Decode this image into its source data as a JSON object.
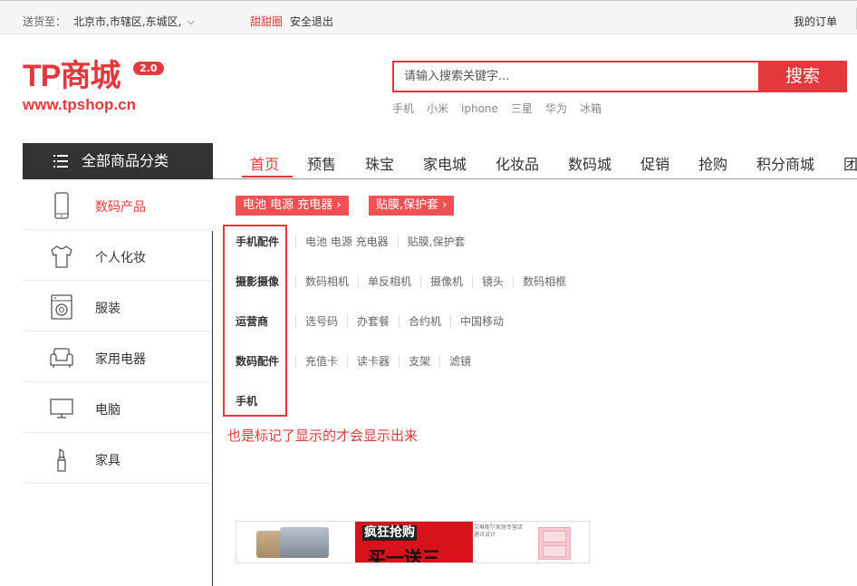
{
  "topbar": {
    "deliver_label": "送货至：",
    "location": "北京市,市辖区,东城区,",
    "username": "甜甜圈",
    "logout": "安全退出",
    "my_orders": "我的订单"
  },
  "logo": {
    "brand": "TP商城",
    "version": "2.0",
    "url": "www.tpshop.cn"
  },
  "search": {
    "placeholder": "请输入搜索关键字...",
    "button": "搜索",
    "hot_words": [
      "手机",
      "小米",
      "iphone",
      "三星",
      "华为",
      "冰箱"
    ]
  },
  "category_header": "全部商品分类",
  "nav": [
    "首页",
    "预售",
    "珠宝",
    "家电城",
    "化妆品",
    "数码城",
    "促销",
    "抢购",
    "积分商城",
    "团"
  ],
  "sidebar": [
    {
      "label": "数码产品",
      "icon": "phone-icon"
    },
    {
      "label": "个人化妆",
      "icon": "tshirt-icon"
    },
    {
      "label": "服装",
      "icon": "washer-icon"
    },
    {
      "label": "家用电器",
      "icon": "sofa-icon"
    },
    {
      "label": "电脑",
      "icon": "monitor-icon"
    },
    {
      "label": "家具",
      "icon": "lipstick-icon"
    }
  ],
  "tags": [
    "电池 电源 充电器",
    "贴膜,保护套"
  ],
  "subcategories": [
    {
      "title": "手机配件",
      "links": [
        "电池 电源 充电器",
        "贴膜,保护套"
      ]
    },
    {
      "title": "摄影摄像",
      "links": [
        "数码相机",
        "单反相机",
        "摄像机",
        "镜头",
        "数码相框"
      ]
    },
    {
      "title": "运营商",
      "links": [
        "选号码",
        "办套餐",
        "合约机",
        "中国移动"
      ]
    },
    {
      "title": "数码配件",
      "links": [
        "充值卡",
        "读卡器",
        "支架",
        "滤镜"
      ]
    },
    {
      "title": "手机",
      "links": []
    }
  ],
  "note": "也是标记了显示的才会显示出来",
  "banner": {
    "promo_line1": "疯狂抢购",
    "promo_line2": "买一送三",
    "shop_line1": "艾琳斯尔家居专营店",
    "shop_line2": "通讯设计"
  },
  "colors": {
    "accent": "#e4393c",
    "dark": "#333333"
  }
}
